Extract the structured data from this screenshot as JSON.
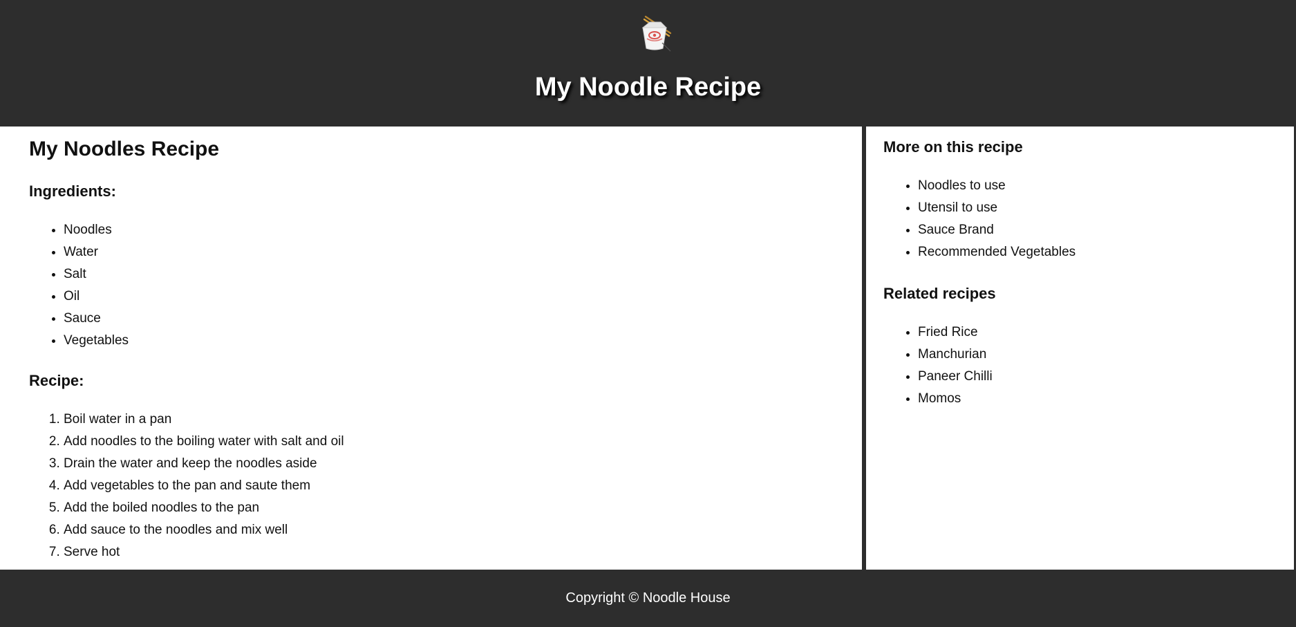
{
  "header": {
    "logo_icon": "noodle-box-icon",
    "title": "My Noodle Recipe"
  },
  "main": {
    "heading": "My Noodles Recipe",
    "ingredients_heading": "Ingredients:",
    "ingredients": [
      "Noodles",
      "Water",
      "Salt",
      "Oil",
      "Sauce",
      "Vegetables"
    ],
    "recipe_heading": "Recipe:",
    "steps": [
      "Boil water in a pan",
      "Add noodles to the boiling water with salt and oil",
      "Drain the water and keep the noodles aside",
      "Add vegetables to the pan and saute them",
      "Add the boiled noodles to the pan",
      "Add sauce to the noodles and mix well",
      "Serve hot"
    ]
  },
  "aside": {
    "more_heading": "More on this recipe",
    "more_items": [
      "Noodles to use",
      "Utensil to use",
      "Sauce Brand",
      "Recommended Vegetables"
    ],
    "related_heading": "Related recipes",
    "related_items": [
      "Fried Rice",
      "Manchurian",
      "Paneer Chilli",
      "Momos"
    ]
  },
  "footer": {
    "copyright": "Copyright © Noodle House"
  },
  "colors": {
    "dark": "#2d2d2d",
    "panel": "#ffffff",
    "text": "#111111"
  }
}
